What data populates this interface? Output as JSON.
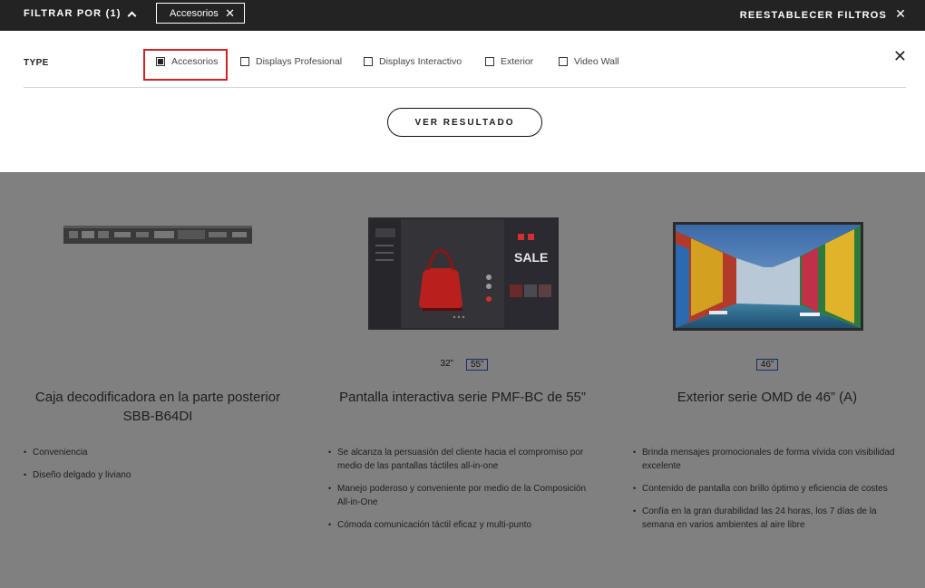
{
  "topbar": {
    "filter_label": "FILTRAR POR (1)",
    "chip_label": "Accesorios",
    "chip_close": "✕",
    "reset_label": "REESTABLECER FILTROS",
    "reset_close": "✕"
  },
  "panel": {
    "type_label": "TYPE",
    "options": [
      {
        "label": "Accesorios",
        "checked": true
      },
      {
        "label": "Displays Profesional",
        "checked": false
      },
      {
        "label": "Displays Interactivo",
        "checked": false
      },
      {
        "label": "Exterior",
        "checked": false
      },
      {
        "label": "Video Wall",
        "checked": false
      }
    ],
    "close_icon": "✕",
    "button_label": "VER RESULTADO"
  },
  "products": [
    {
      "title": "Caja decodificadora en la parte posterior SBB-B64DI",
      "sizes": [],
      "bullets": [
        "Conveniencia",
        "Diseño delgado y liviano"
      ]
    },
    {
      "title": "Pantalla interactiva serie PMF-BC de 55”",
      "sizes": [
        {
          "label": "32”",
          "active": false
        },
        {
          "label": "55”",
          "active": true
        }
      ],
      "screen_text": "SALE",
      "bullets": [
        "Se alcanza la persuasión del cliente hacia el compromiso por medio de las pantallas táctiles all-in-one",
        "Manejo poderoso y conveniente por medio de la Composición All-in-One",
        "Cómoda comunicación táctil eficaz y multi-punto"
      ]
    },
    {
      "title": "Exterior serie OMD de 46” (A)",
      "sizes": [
        {
          "label": "46”",
          "active": true
        }
      ],
      "bullets": [
        "Brinda mensajes promocionales de forma vívida con visibilidad excelente",
        "Contenido de pantalla con brillo óptimo y eficiencia de costes",
        "Confía en la gran durabilidad las 24 horas, los 7 días de la semana en varios ambientes al aire libre"
      ]
    }
  ]
}
